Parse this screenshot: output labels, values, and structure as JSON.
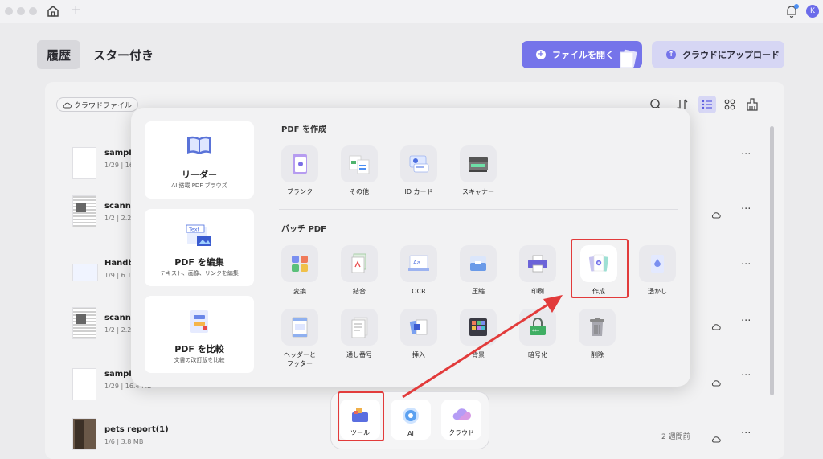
{
  "window": {
    "avatar_letter": "K"
  },
  "header": {
    "tabs": [
      {
        "label": "履歴",
        "active": true
      },
      {
        "label": "スター付き",
        "active": false
      }
    ],
    "open_file_label": "ファイルを開く",
    "upload_label": "クラウドにアップロード"
  },
  "toolbar": {
    "cloud_filter_label": "クラウドファイル"
  },
  "files": [
    {
      "name": "sample-",
      "meta": "1/29 | 16"
    },
    {
      "name": "scannec",
      "meta": "1/2 | 2.2"
    },
    {
      "name": "Handbu",
      "meta": "1/9 | 6.1"
    },
    {
      "name": "scannec",
      "meta": "1/2 | 2.2"
    },
    {
      "name": "sample-",
      "meta": "1/29 | 16.4 MB"
    },
    {
      "name": "pets report(1)",
      "meta": "1/6 | 3.8 MB",
      "time": "2 週間前"
    }
  ],
  "popup": {
    "cards": [
      {
        "title": "リーダー",
        "subtitle": "AI 搭載 PDF ブラウズ"
      },
      {
        "title": "PDF を編集",
        "subtitle": "テキスト、画像、リンクを編集",
        "icon_text": "Text"
      },
      {
        "title": "PDF を比較",
        "subtitle": "文書の改訂版を比較"
      }
    ],
    "create_section": {
      "title": "PDF を作成",
      "tools": [
        {
          "label": "ブランク"
        },
        {
          "label": "その他"
        },
        {
          "label": "ID カード"
        },
        {
          "label": "スキャナー"
        }
      ]
    },
    "batch_section": {
      "title": "バッチ PDF",
      "row1": [
        {
          "label": "変換"
        },
        {
          "label": "結合"
        },
        {
          "label": "OCR",
          "icon_text": "Aa"
        },
        {
          "label": "圧縮"
        },
        {
          "label": "印刷"
        },
        {
          "label": "作成",
          "highlighted": true
        },
        {
          "label": "透かし"
        }
      ],
      "row2": [
        {
          "label_line1": "ヘッダーと",
          "label_line2": "フッター"
        },
        {
          "label": "通し番号"
        },
        {
          "label": "挿入"
        },
        {
          "label": "背景"
        },
        {
          "label": "暗号化"
        },
        {
          "label": "削除"
        }
      ]
    }
  },
  "dock": {
    "items": [
      {
        "label": "ツール",
        "highlighted": true
      },
      {
        "label": "AI"
      },
      {
        "label": "クラウド"
      }
    ]
  },
  "colors": {
    "accent": "#7574ea",
    "highlight_red": "#e23b3b"
  }
}
